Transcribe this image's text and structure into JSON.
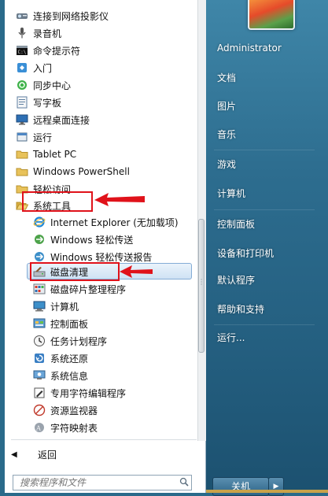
{
  "left_menu": {
    "items": [
      {
        "label": "连接到网络投影仪",
        "icon": "projector-icon"
      },
      {
        "label": "录音机",
        "icon": "microphone-icon"
      },
      {
        "label": "命令提示符",
        "icon": "command-prompt-icon"
      },
      {
        "label": "入门",
        "icon": "getting-started-icon"
      },
      {
        "label": "同步中心",
        "icon": "sync-center-icon"
      },
      {
        "label": "写字板",
        "icon": "wordpad-icon"
      },
      {
        "label": "远程桌面连接",
        "icon": "remote-desktop-icon"
      },
      {
        "label": "运行",
        "icon": "run-icon"
      },
      {
        "label": "Tablet PC",
        "icon": "folder-icon"
      },
      {
        "label": "Windows PowerShell",
        "icon": "folder-icon"
      },
      {
        "label": "轻松访问",
        "icon": "folder-icon"
      },
      {
        "label": "系统工具",
        "icon": "folder-open-icon"
      },
      {
        "label": "Internet Explorer (无加载项)",
        "icon": "internet-explorer-icon"
      },
      {
        "label": "Windows 轻松传送",
        "icon": "easy-transfer-icon"
      },
      {
        "label": "Windows 轻松传送报告",
        "icon": "easy-transfer-report-icon"
      },
      {
        "label": "磁盘清理",
        "icon": "disk-cleanup-icon"
      },
      {
        "label": "磁盘碎片整理程序",
        "icon": "defragmenter-icon"
      },
      {
        "label": "计算机",
        "icon": "computer-icon"
      },
      {
        "label": "控制面板",
        "icon": "control-panel-icon"
      },
      {
        "label": "任务计划程序",
        "icon": "task-scheduler-icon"
      },
      {
        "label": "系统还原",
        "icon": "system-restore-icon"
      },
      {
        "label": "系统信息",
        "icon": "system-info-icon"
      },
      {
        "label": "专用字符编辑程序",
        "icon": "char-editor-icon"
      },
      {
        "label": "资源监视器",
        "icon": "resource-monitor-icon"
      },
      {
        "label": "字符映射表",
        "icon": "character-map-icon"
      }
    ],
    "back_label": "返回",
    "search_placeholder": "搜索程序和文件"
  },
  "right_menu": {
    "items": [
      {
        "label": "Administrator"
      },
      {
        "label": "文档"
      },
      {
        "label": "图片"
      },
      {
        "label": "音乐"
      },
      {
        "label": "游戏"
      },
      {
        "label": "计算机"
      },
      {
        "label": "控制面板"
      },
      {
        "label": "设备和打印机"
      },
      {
        "label": "默认程序"
      },
      {
        "label": "帮助和支持"
      },
      {
        "label": "运行..."
      }
    ],
    "shutdown_label": "关机"
  },
  "colors": {
    "annotation_red": "#e0121a",
    "highlight_blue": "#cfe2f4",
    "pane_blue": "#2d6d8f"
  }
}
